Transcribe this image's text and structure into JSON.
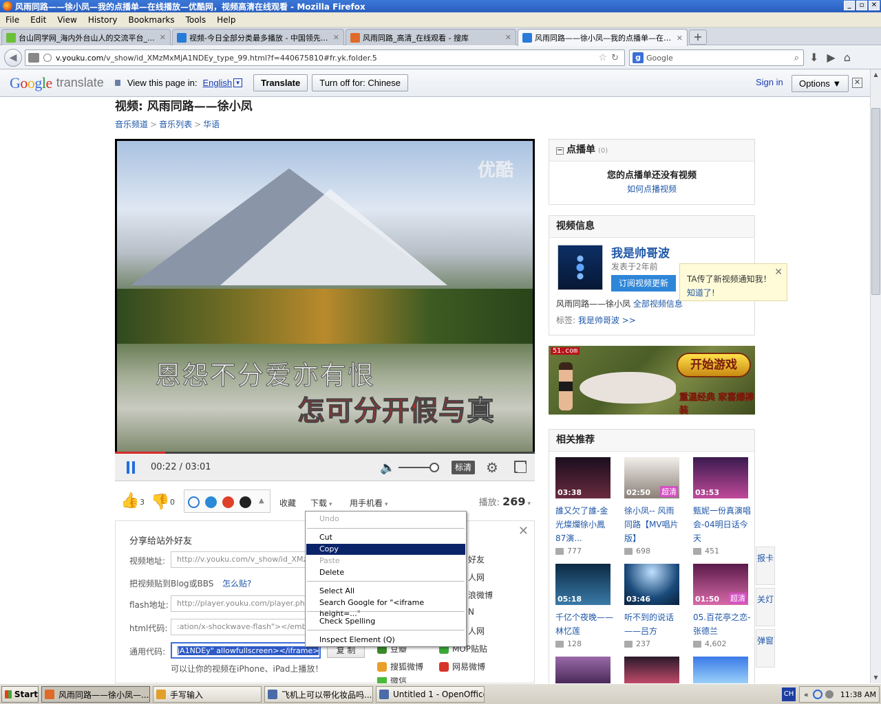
{
  "window": {
    "title": "风雨同路——徐小凤—我的点播单—在线播放—优酷网，视频高清在线观看 - Mozilla Firefox",
    "buttons": [
      "_",
      "▫",
      "✕"
    ]
  },
  "menu": [
    "File",
    "Edit",
    "View",
    "History",
    "Bookmarks",
    "Tools",
    "Help"
  ],
  "tabs": [
    {
      "label": "台山同学网_海内外台山人的交流平台_...",
      "fav_color": "#6bbf3a"
    },
    {
      "label": "视频-今日全部分类最多播放 - 中国领先...",
      "fav_color": "#2a7ad8"
    },
    {
      "label": "风雨同路_高清_在线观看 - 搜库",
      "fav_color": "#e06a2a"
    },
    {
      "label": "风雨同路——徐小凤—我的点播单—在线...",
      "fav_color": "#2a7ad8"
    }
  ],
  "tab_close": "✕",
  "new_tab": "+",
  "nav": {
    "back": "◀",
    "url_host": "v.youku.com",
    "url_rest": "/v_show/id_XMzMxMjA1NDEy_type_99.html?f=440675810#fr.yk.folder.5",
    "star": "☆",
    "reload": "↻",
    "search_engine": "g",
    "search_placeholder": "Google",
    "magnifier": "⌕",
    "icons": [
      "⬇",
      "▶",
      "⌂"
    ]
  },
  "translate_bar": {
    "logo": [
      "G",
      "o",
      "o",
      "g",
      "l",
      "e"
    ],
    "word": "translate",
    "view_label": "View this page in:",
    "language": "English",
    "dd": "▼",
    "translate_btn": "Translate",
    "turnoff_btn": "Turn off for: Chinese",
    "signin": "Sign in",
    "options": "Options ▼",
    "close": "✕"
  },
  "scrollbar": {
    "up": "▲",
    "down": "▼"
  },
  "page": {
    "title": "视频: 风雨同路——徐小凤",
    "crumbs": [
      "音乐频道",
      "音乐列表",
      "华语"
    ],
    "crumb_sep": ">"
  },
  "video": {
    "watermark": "优酷",
    "subtitle_1": "恩怨不分爱亦有恨",
    "subtitle_2_red": "怎可分开假与",
    "subtitle_2_white": "真",
    "progress_fraction": 0.12,
    "time": "00:22 / 03:01",
    "volume_icon": "🔈",
    "quality": "标清",
    "gear": "⚙"
  },
  "actions": {
    "like_icon": "👍",
    "like_count": "3",
    "dislike_icon": "👎",
    "dislike_count": "0",
    "collect": "收藏",
    "download": "下载",
    "mobile": "用手机看",
    "caret": "▾",
    "share_caret": "▲",
    "plays_label": "播放:",
    "plays_count": "269"
  },
  "share": {
    "title": "分享给站外好友",
    "close": "✕",
    "video_addr_label": "视频地址:",
    "video_addr_value": "http://v.youku.com/v_show/id_XMzM",
    "blog_label": "把视频贴到Blog或BBS",
    "how_link": "怎么贴?",
    "flash_label": "flash地址:",
    "flash_value": "http://player.youku.com/player.php/",
    "html_label": "html代码:",
    "html_value": ":ation/x-shockwave-flash\"></embe",
    "generic_label": "通用代码:",
    "generic_value": "jA1NDEy\" allowfullscreen></iframe>",
    "copy_btn": "复 制",
    "note": "可以让你的视频在iPhone、iPad上播放！",
    "sns": [
      {
        "label": "好友",
        "color": "#e8572d"
      },
      {
        "label": "人网",
        "color": "#2a6fd8"
      },
      {
        "label": "浪微博",
        "color": "#d8352a"
      },
      {
        "label": "N",
        "color": "#777777"
      },
      {
        "label": "人网",
        "color": "#2a6fd8"
      },
      {
        "label": "豆瓣",
        "color": "#3a8a2a"
      },
      {
        "label": "MOP贴贴",
        "color": "#3aa83a"
      },
      {
        "label": "搜狐微博",
        "color": "#e8a02a"
      },
      {
        "label": "网易微博",
        "color": "#d8352a"
      },
      {
        "label": "微信",
        "color": "#4aba3a"
      }
    ]
  },
  "context_menu": {
    "undo": "Undo",
    "cut": "Cut",
    "copy": "Copy",
    "paste": "Paste",
    "delete": "Delete",
    "select_all": "Select All",
    "search": "Search Google for \"<iframe height=...\"",
    "spell": "Check Spelling",
    "inspect": "Inspect Element (Q)"
  },
  "playlist": {
    "title": "点播单",
    "count": "(0)",
    "minus": "−",
    "empty": "您的点播单还没有视频",
    "howto": "如何点播视频"
  },
  "video_info": {
    "title": "视频信息",
    "uploader": "我是帅哥波",
    "posted": "发表于2年前",
    "subscribe": "订阅视频更新",
    "vtitle": "风雨同路——徐小凤",
    "all_videos": "全部视频信息",
    "tags_label": "标签:",
    "tag": "我是帅哥波 >>"
  },
  "tooltip": {
    "text": "TA传了新视频通知我！",
    "ok": "知道了!",
    "close": "✕"
  },
  "ad": {
    "brand": "51.com",
    "play": "开始游戏",
    "slogan": "重温经典 家喜爆棒装"
  },
  "related": {
    "title": "相关推荐",
    "items": [
      {
        "duration": "03:38",
        "hd": "",
        "title": "誰又欠了誰-金光燦爛徐小鳳87演...",
        "count": "777",
        "thumb": "#3a1a2e"
      },
      {
        "duration": "02:50",
        "hd": "超清",
        "title": "徐小凤-- 风雨同路【MV唱片版】",
        "count": "698",
        "thumb": "#d8d2cc"
      },
      {
        "duration": "03:53",
        "hd": "",
        "title": "甄妮一份真演唱会-04明日话今天",
        "count": "451",
        "thumb": "#6a2a6a"
      },
      {
        "duration": "05:18",
        "hd": "",
        "title": "千亿个夜晚——林忆莲",
        "count": "128",
        "thumb": "#0e3a5a"
      },
      {
        "duration": "03:46",
        "hd": "",
        "title": "听不到的说话——吕方",
        "count": "237",
        "thumb": "#1a4a7a"
      },
      {
        "duration": "01:50",
        "hd": "超清",
        "title": "05.百花亭之恋-张德兰",
        "count": "4,602",
        "thumb": "#8a2a6a"
      }
    ]
  },
  "side_tabs": [
    "报卡",
    "关灯",
    "弹窗"
  ],
  "taskbar": {
    "start": "Start",
    "tasks": [
      {
        "label": "风雨同路——徐小凤—...",
        "icon": "#e06a2a"
      },
      {
        "label": "手写输入",
        "icon": "#e0a02a"
      },
      {
        "label": "飞机上可以带化妆品吗...",
        "icon": "#4a6aa8"
      },
      {
        "label": "Untitled 1 - OpenOffice....",
        "icon": "#4a6aa8"
      }
    ],
    "lang": "CH",
    "clock": "11:38 AM",
    "tray_chevron": "«"
  }
}
